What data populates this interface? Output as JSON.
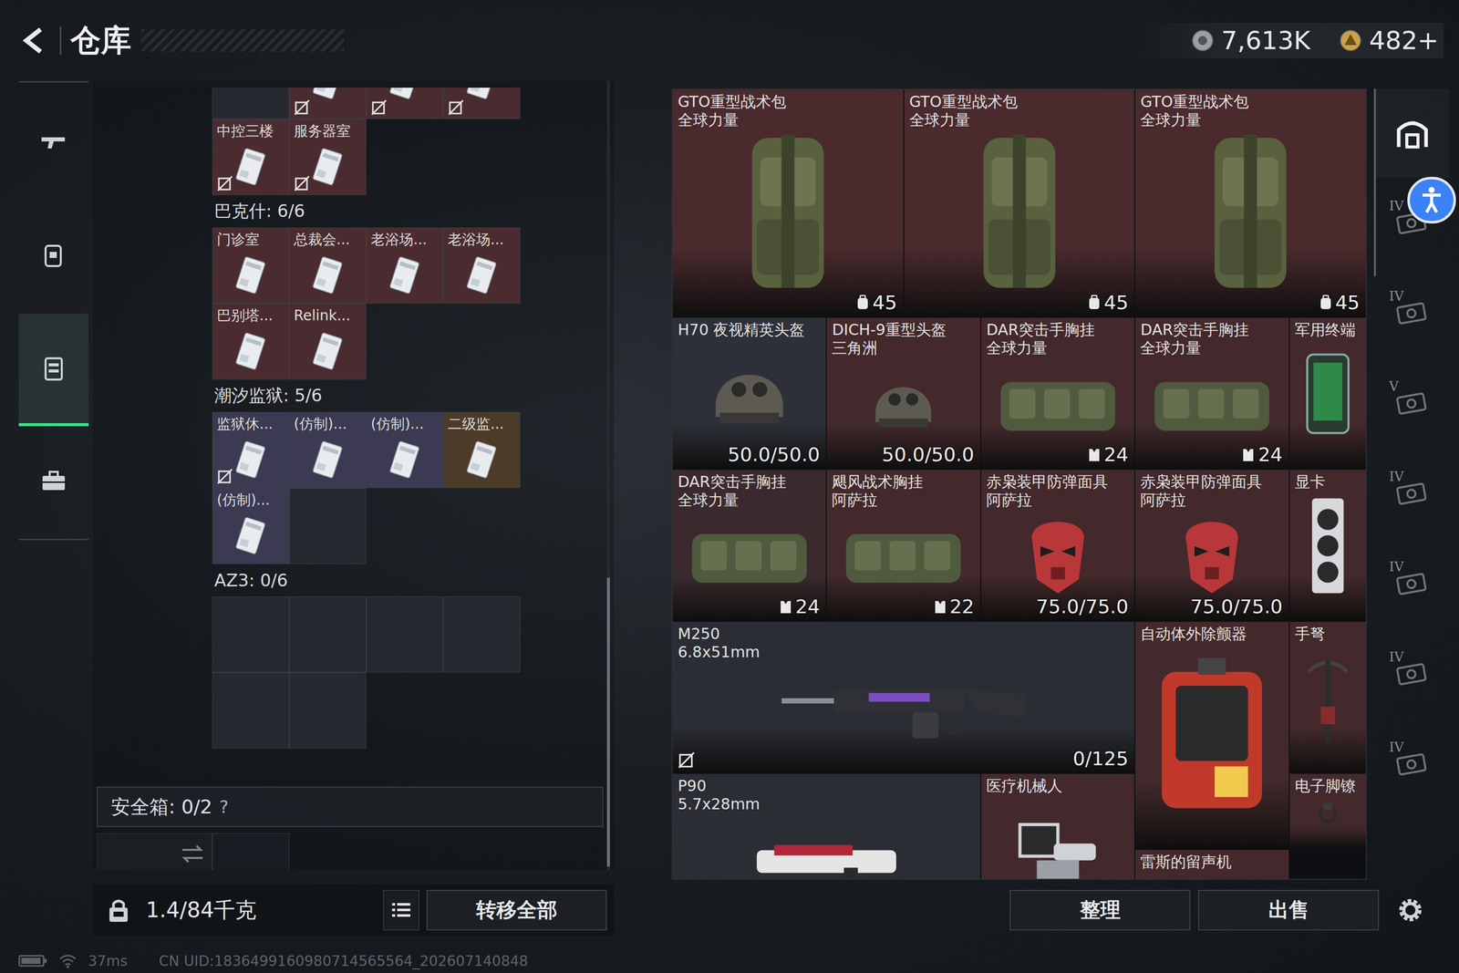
{
  "header": {
    "title": "仓库",
    "currencies": [
      {
        "amount": "7,613K",
        "kind": "silver"
      },
      {
        "amount": "482+",
        "kind": "gold"
      }
    ]
  },
  "nav": [
    {
      "kind": "weapon",
      "selected": false
    },
    {
      "kind": "gear",
      "selected": false
    },
    {
      "kind": "storage",
      "selected": true
    },
    {
      "kind": "toolbox",
      "selected": false
    }
  ],
  "keys": {
    "clipped": [
      {
        "filled": false,
        "locked": false,
        "color": "#262a30"
      },
      {
        "filled": true,
        "locked": true,
        "color": "#4a2c30"
      },
      {
        "filled": true,
        "locked": true,
        "color": "#4a2c30"
      },
      {
        "filled": true,
        "locked": true,
        "color": "#4a2c30"
      }
    ],
    "sections": [
      {
        "cards": [
          {
            "filled": true,
            "name": "中控三楼",
            "locked": true,
            "color": "#4a2c30"
          },
          {
            "filled": true,
            "name": "服务器室",
            "locked": true,
            "color": "#4a2c30"
          }
        ]
      },
      {
        "title": "巴克什: 6/6",
        "cards": [
          {
            "filled": true,
            "name": "门诊室",
            "locked": false,
            "color": "#4a2c30"
          },
          {
            "filled": true,
            "name": "总裁会...",
            "locked": false,
            "color": "#4a2c30"
          },
          {
            "filled": true,
            "name": "老浴场...",
            "locked": false,
            "color": "#4a2c30"
          },
          {
            "filled": true,
            "name": "老浴场...",
            "locked": false,
            "color": "#4a2c30"
          },
          {
            "filled": true,
            "name": "巴别塔...",
            "locked": false,
            "color": "#4a2c30"
          },
          {
            "filled": true,
            "name": "Relink...",
            "locked": false,
            "color": "#4a2c30"
          }
        ]
      },
      {
        "title": "潮汐监狱: 5/6",
        "cards": [
          {
            "filled": true,
            "name": "监狱休...",
            "locked": true,
            "color": "#3b3a52"
          },
          {
            "filled": true,
            "name": "(仿制)...",
            "locked": false,
            "color": "#3b3a52"
          },
          {
            "filled": true,
            "name": "(仿制)...",
            "locked": false,
            "color": "#3b3a52"
          },
          {
            "filled": true,
            "name": "二级监...",
            "locked": false,
            "color": "#4d3b2a"
          },
          {
            "filled": true,
            "name": "(仿制)...",
            "locked": false,
            "color": "#3b3a52"
          },
          {
            "filled": false,
            "locked": false,
            "color": "#262a30"
          }
        ]
      },
      {
        "title": "AZ3: 0/6",
        "cards": [
          {
            "filled": false,
            "locked": false,
            "color": "#262a30"
          },
          {
            "filled": false,
            "locked": false,
            "color": "#262a30"
          },
          {
            "filled": false,
            "locked": false,
            "color": "#262a30"
          },
          {
            "filled": false,
            "locked": false,
            "color": "#262a30"
          },
          {
            "filled": false,
            "locked": false,
            "color": "#262a30"
          },
          {
            "filled": false,
            "locked": false,
            "color": "#262a30"
          }
        ]
      }
    ]
  },
  "safe_box": {
    "label": "安全箱: 0/2",
    "help": "?"
  },
  "weight": "1.4/84千克",
  "transfer": "转移全部",
  "items": [
    {
      "title": "GTO重型战术包",
      "subtitle": "全球力量",
      "kind": "backpack",
      "value": "45",
      "value_kind": "capacity",
      "locked": false,
      "color": "#4a2a2d"
    },
    {
      "title": "GTO重型战术包",
      "subtitle": "全球力量",
      "kind": "backpack",
      "value": "45",
      "value_kind": "capacity",
      "locked": false,
      "color": "#4a2a2d"
    },
    {
      "title": "GTO重型战术包",
      "subtitle": "全球力量",
      "kind": "backpack",
      "value": "45",
      "value_kind": "capacity",
      "locked": false,
      "color": "#4a2a2d"
    },
    {
      "title": "H70 夜视精英头盔",
      "kind": "helmet",
      "value": "50.0/50.0",
      "value_kind": "durability",
      "locked": false,
      "color": "#2d3038"
    },
    {
      "title": "DICH-9重型头盔",
      "subtitle": "三角洲",
      "kind": "helmet",
      "value": "50.0/50.0",
      "value_kind": "durability",
      "locked": false,
      "color": "#43292b"
    },
    {
      "title": "DAR突击手胸挂",
      "subtitle": "全球力量",
      "kind": "rig",
      "value": "24",
      "value_kind": "slots",
      "locked": false,
      "color": "#43292b"
    },
    {
      "title": "DAR突击手胸挂",
      "subtitle": "全球力量",
      "kind": "rig",
      "value": "24",
      "value_kind": "slots",
      "locked": false,
      "color": "#43292b"
    },
    {
      "title": "军用终端",
      "kind": "terminal",
      "locked": false,
      "color": "#43292b"
    },
    {
      "title": "DAR突击手胸挂",
      "subtitle": "全球力量",
      "kind": "rig",
      "value": "24",
      "value_kind": "slots",
      "locked": false,
      "color": "#3a2a2d"
    },
    {
      "title": "飓风战术胸挂",
      "subtitle": "阿萨拉",
      "kind": "rig",
      "value": "22",
      "value_kind": "slots",
      "locked": false,
      "color": "#43292b"
    },
    {
      "title": "赤枭装甲防弹面具",
      "subtitle": "阿萨拉",
      "kind": "mask",
      "value": "75.0/75.0",
      "value_kind": "durability",
      "locked": false,
      "color": "#43292b"
    },
    {
      "title": "赤枭装甲防弹面具",
      "subtitle": "阿萨拉",
      "kind": "mask",
      "value": "75.0/75.0",
      "value_kind": "durability",
      "locked": false,
      "color": "#43292b"
    },
    {
      "title": "显卡",
      "kind": "gpu",
      "locked": false,
      "color": "#43292b"
    },
    {
      "title": "M250",
      "subtitle": "6.8x51mm",
      "kind": "lmg",
      "value": "0/125",
      "value_kind": "ammo",
      "locked": true,
      "color": "#2a2d33"
    },
    {
      "title": "自动体外除颤器",
      "kind": "aed",
      "locked": false,
      "color": "#43292b"
    },
    {
      "title": "手弩",
      "kind": "crossbow",
      "locked": false,
      "color": "#43292b"
    },
    {
      "title": "P90",
      "subtitle": "5.7x28mm",
      "kind": "smg",
      "locked": false,
      "color": "#2a2d33"
    },
    {
      "title": "医疗机械人",
      "kind": "robot",
      "locked": false,
      "color": "#43292b"
    },
    {
      "title": "电子脚镣",
      "kind": "anklet",
      "locked": false,
      "color": "#43292b"
    },
    {
      "title": "雷斯的留声机",
      "kind": "gramophone",
      "locked": false,
      "color": "#43292b"
    }
  ],
  "side_tabs": [
    {
      "kind": "home",
      "selected": true
    },
    {
      "kind": "tier",
      "label": "IV",
      "selected": false
    },
    {
      "kind": "tier",
      "label": "IV",
      "selected": false
    },
    {
      "kind": "tier",
      "label": "V",
      "selected": false
    },
    {
      "kind": "tier",
      "label": "IV",
      "selected": false
    },
    {
      "kind": "tier",
      "label": "IV",
      "selected": false
    },
    {
      "kind": "tier",
      "label": "IV",
      "selected": false
    },
    {
      "kind": "tier",
      "label": "IV",
      "selected": false
    }
  ],
  "actions": [
    "整理",
    "出售"
  ],
  "status": {
    "ping": "37ms",
    "uid": "CN UID:1836499160980714565564_202607140848"
  }
}
